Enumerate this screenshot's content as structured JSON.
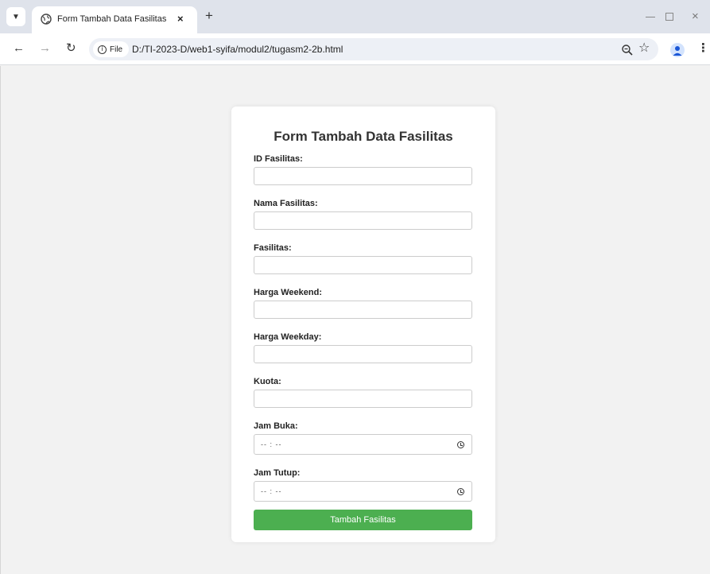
{
  "browser": {
    "tab_title": "Form Tambah Data Fasilitas",
    "tab_close": "×",
    "new_tab": "+",
    "window_close": "×",
    "file_chip_label": "File",
    "url": "D:/TI-2023-D/web1-syifa/modul2/tugasm2-2b.html",
    "icons": [
      "chevron-down-icon",
      "globe-icon",
      "close-icon",
      "plus-icon",
      "minimize-icon",
      "maximize-icon",
      "back-icon",
      "forward-icon",
      "reload-icon",
      "info-icon",
      "zoom-icon",
      "star-icon",
      "profile-icon",
      "kebab-icon"
    ]
  },
  "form": {
    "title": "Form Tambah Data Fasilitas",
    "fields": [
      {
        "label": "ID Fasilitas:",
        "value": "",
        "type": "text"
      },
      {
        "label": "Nama Fasilitas:",
        "value": "",
        "type": "text"
      },
      {
        "label": "Fasilitas:",
        "value": "",
        "type": "text"
      },
      {
        "label": "Harga Weekend:",
        "value": "",
        "type": "text"
      },
      {
        "label": "Harga Weekday:",
        "value": "",
        "type": "text"
      },
      {
        "label": "Kuota:",
        "value": "",
        "type": "text"
      },
      {
        "label": "Jam Buka:",
        "placeholder": "-- : --",
        "type": "time"
      },
      {
        "label": "Jam Tutup:",
        "placeholder": "-- : --",
        "type": "time"
      }
    ],
    "submit_label": "Tambah Fasilitas"
  },
  "colors": {
    "button_bg": "#4caf50",
    "page_bg": "#f2f2f2",
    "tabstrip_bg": "#dfe3eb"
  }
}
